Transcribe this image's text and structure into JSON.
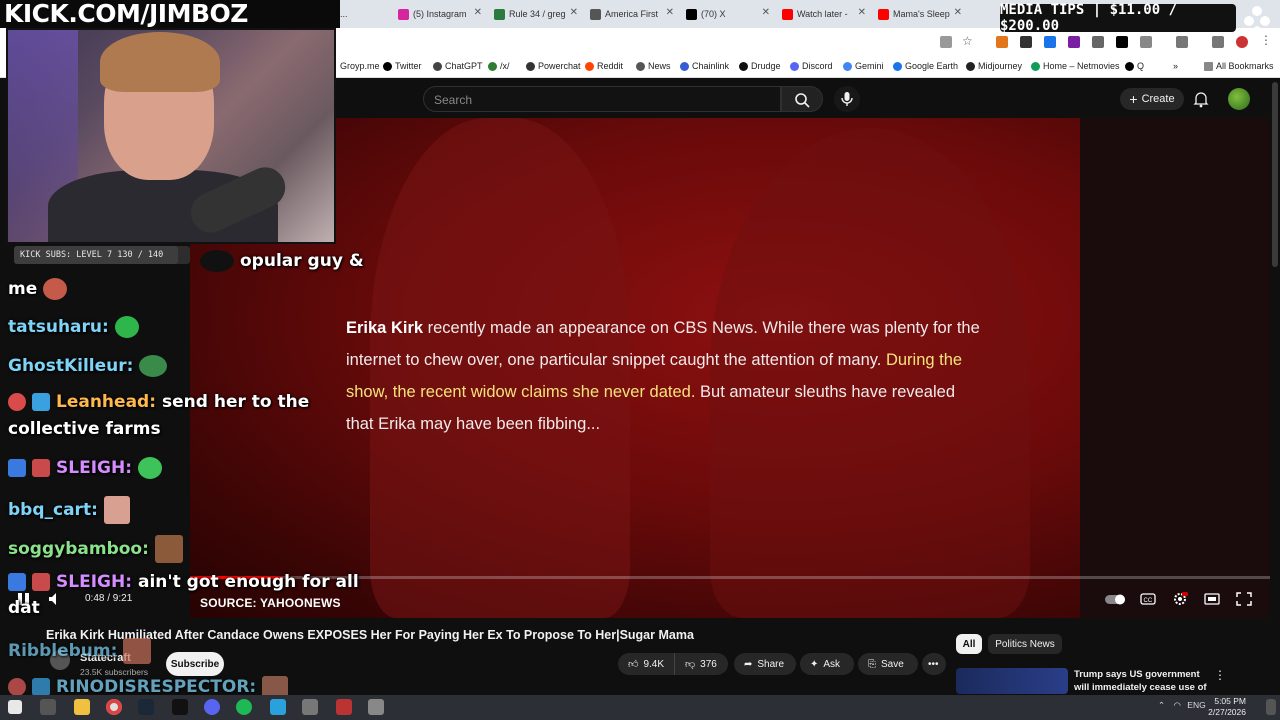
{
  "browser": {
    "tabs": [
      {
        "label": "(5) Instagram",
        "color": "#d6249f"
      },
      {
        "label": "Rule 34 / greg",
        "color": "#2b7a3e"
      },
      {
        "label": "America First",
        "color": "#555555"
      },
      {
        "label": "(70) X",
        "color": "#000000"
      },
      {
        "label": "Watch later -",
        "color": "#ff0000"
      },
      {
        "label": "Mama's Sleep",
        "color": "#ff0000"
      }
    ],
    "bookmarks": [
      {
        "label": "Twitter",
        "color": "#000000"
      },
      {
        "label": "ChatGPT",
        "color": "#444444"
      },
      {
        "label": "/x/",
        "color": "#2e7d32"
      },
      {
        "label": "Powerchat",
        "color": "#333333"
      },
      {
        "label": "Reddit",
        "color": "#ff4500"
      },
      {
        "label": "News",
        "color": "#555555"
      },
      {
        "label": "Chainlink",
        "color": "#375bd2"
      },
      {
        "label": "Drudge",
        "color": "#111111"
      },
      {
        "label": "Discord",
        "color": "#5865f2"
      },
      {
        "label": "Gemini",
        "color": "#4285f4"
      },
      {
        "label": "Google Earth",
        "color": "#1a73e8"
      },
      {
        "label": "Midjourney",
        "color": "#222222"
      },
      {
        "label": "Home – Netmovies",
        "color": "#0f9d58"
      },
      {
        "label": "Q",
        "color": "#000000"
      }
    ],
    "partial_bookmark": "Groyp.me",
    "all_bookmarks": "All Bookmarks"
  },
  "youtube": {
    "search_placeholder": "Search",
    "create_label": "Create",
    "video": {
      "caption_name": "Erika Kirk",
      "caption_part1": " recently made an appearance on CBS News. While there was plenty for the internet to chew over, one particular snippet caught the attention of many. ",
      "caption_highlight": "During the show, the recent widow claims she never dated.",
      "caption_part2": " But amateur sleuths have revealed that Erika may have been fibbing...",
      "time": "0:48 / 9:21",
      "progress": 0.085,
      "source": "SOURCE: YAHOONEWS"
    },
    "title": "Erika Kirk Humiliated After Candace Owens EXPOSES Her For Paying Her Ex To Propose To Her|Sugar Mama",
    "channel": {
      "name": "Statecraft",
      "subs": "23.5K subscribers",
      "subscribe": "Subscribe"
    },
    "actions": {
      "likes": "9.4K",
      "dislikes": "376",
      "share": "Share",
      "ask": "Ask",
      "save": "Save"
    },
    "chips": [
      "All",
      "Politics News"
    ],
    "related": {
      "title": "Trump says US government will immediately cease use of ..."
    }
  },
  "overlay": {
    "kick_banner": "KICK.COM/JIMBOZ",
    "subs_bar": "KICK SUBS: LEVEL 7 130 / 140",
    "subs_progress": 0.93,
    "media_tips": "MEDIA TIPS | $11.00 / $200.00"
  },
  "chat": [
    {
      "user": "",
      "text": "opular guy &",
      "user_color": "#ffffff"
    },
    {
      "user": "",
      "text": "me",
      "user_color": "#ffffff"
    },
    {
      "user": "tatsuharu:",
      "text": "",
      "user_color": "#7ed3f7"
    },
    {
      "user": "GhostKilleur:",
      "text": "",
      "user_color": "#7ed3f7"
    },
    {
      "user": "Leanhead:",
      "text": "send her to the",
      "user_color": "#ffb84d"
    },
    {
      "user": "",
      "text": "collective farms",
      "user_color": "#ffffff"
    },
    {
      "user": "SLEIGH:",
      "text": "",
      "user_color": "#d58cff"
    },
    {
      "user": "bbq_cart:",
      "text": "",
      "user_color": "#7ed3f7"
    },
    {
      "user": "soggybamboo:",
      "text": "",
      "user_color": "#8be28b"
    },
    {
      "user": "SLEIGH:",
      "text": "ain't got enough for all",
      "user_color": "#d58cff"
    },
    {
      "user": "",
      "text": "dat",
      "user_color": "#ffffff"
    },
    {
      "user": "Ribblebum:",
      "text": "",
      "user_color": "#7ed3f7"
    },
    {
      "user": "RINODISRESPECTOR:",
      "text": "",
      "user_color": "#7ed3f7"
    }
  ],
  "taskbar": {
    "lang": "ENG",
    "time": "5:05 PM",
    "date": "2/27/2026"
  }
}
